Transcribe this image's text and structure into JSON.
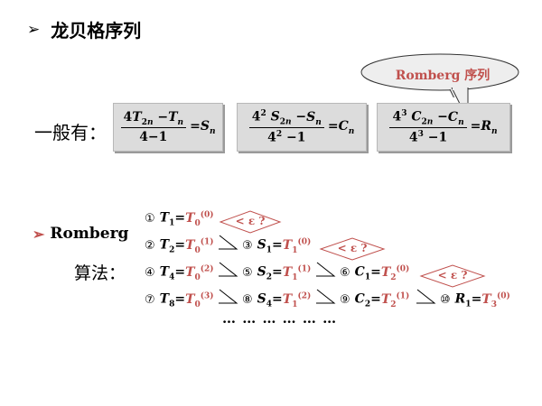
{
  "slide": {
    "title_arrow": "➢",
    "title": "龙贝格序列",
    "callout": "Romberg 序列",
    "general_label": "一般有：",
    "romberg_label": "Romberg",
    "romberg_arrow": "➢",
    "algorithm_label": "算法：",
    "dots": "… … … … … …",
    "epsilon_check": "< ε ?"
  },
  "formulas": [
    {
      "name": "S",
      "numerator": "4T2n −Tn",
      "denominator": "4−1",
      "result": "Sn"
    },
    {
      "name": "C",
      "numerator": "4² S2n −Sn",
      "denominator": "4² −1",
      "result": "Cn"
    },
    {
      "name": "R",
      "numerator": "4³ C2n −Cn",
      "denominator": "4³ −1",
      "result": "Rn"
    }
  ],
  "steps": [
    {
      "num": "①",
      "lhs": "T",
      "lhs_sub": "1",
      "rhs": "T",
      "rhs_sub": "0",
      "rhs_sup": "(0)"
    },
    {
      "num": "②",
      "lhs": "T",
      "lhs_sub": "2",
      "rhs": "T",
      "rhs_sub": "0",
      "rhs_sup": "(1)"
    },
    {
      "num": "③",
      "lhs": "S",
      "lhs_sub": "1",
      "rhs": "T",
      "rhs_sub": "1",
      "rhs_sup": "(0)"
    },
    {
      "num": "④",
      "lhs": "T",
      "lhs_sub": "4",
      "rhs": "T",
      "rhs_sub": "0",
      "rhs_sup": "(2)"
    },
    {
      "num": "⑤",
      "lhs": "S",
      "lhs_sub": "2",
      "rhs": "T",
      "rhs_sub": "1",
      "rhs_sup": "(1)"
    },
    {
      "num": "⑥",
      "lhs": "C",
      "lhs_sub": "1",
      "rhs": "T",
      "rhs_sub": "2",
      "rhs_sup": "(0)"
    },
    {
      "num": "⑦",
      "lhs": "T",
      "lhs_sub": "8",
      "rhs": "T",
      "rhs_sub": "0",
      "rhs_sup": "(3)"
    },
    {
      "num": "⑧",
      "lhs": "S",
      "lhs_sub": "4",
      "rhs": "T",
      "rhs_sub": "1",
      "rhs_sup": "(2)"
    },
    {
      "num": "⑨",
      "lhs": "C",
      "lhs_sub": "2",
      "rhs": "T",
      "rhs_sub": "2",
      "rhs_sup": "(1)"
    },
    {
      "num": "⑩",
      "lhs": "R",
      "lhs_sub": "1",
      "rhs": "T",
      "rhs_sub": "3",
      "rhs_sup": "(0)"
    }
  ],
  "colors": {
    "accent": "#c0504d",
    "box_bg": "#dcdcdc",
    "cloud_bg": "#eeeeee"
  }
}
